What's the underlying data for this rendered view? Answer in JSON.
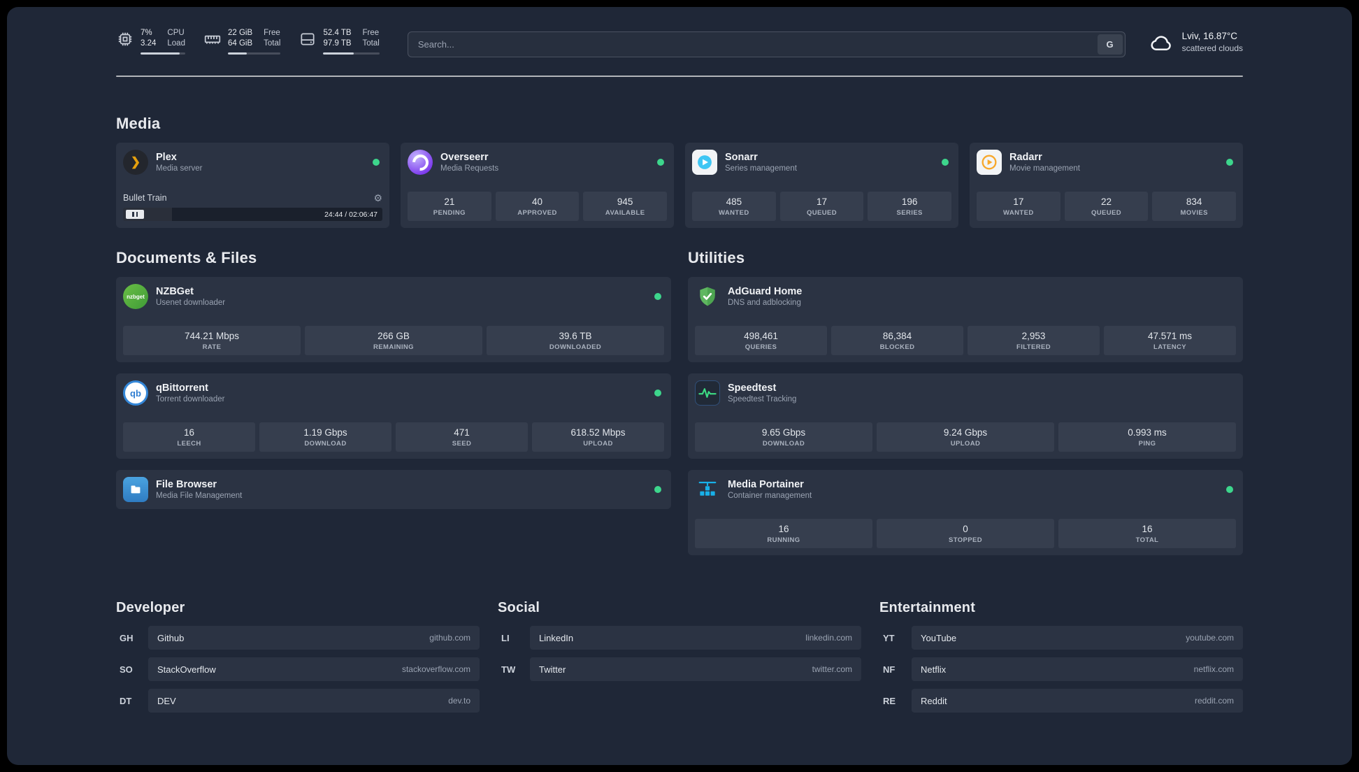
{
  "colors": {
    "status_online": "#3dd68c",
    "accent_plex": "#e5a00d",
    "accent_overseerr": "#7c3aed",
    "accent_sonarr": "#3ec6f4",
    "accent_radarr": "#f7a82c",
    "accent_nzbget": "#54b947",
    "accent_qbittorrent": "#2e7dd1",
    "accent_filebrowser": "#3f9bd8",
    "accent_adguard": "#5fb760",
    "accent_speedtest": "#3ddc84",
    "accent_portainer": "#18b0e8"
  },
  "icons": {
    "gear": "⚙",
    "plex_chevron": "❯"
  },
  "topbar": {
    "cpu": {
      "value_top": "7%",
      "value_bottom": "3.24",
      "label_top": "CPU",
      "label_bottom": "Load"
    },
    "memory": {
      "value_top": "22 GiB",
      "value_bottom": "64 GiB",
      "label_top": "Free",
      "label_bottom": "Total"
    },
    "disk": {
      "value_top": "52.4 TB",
      "value_bottom": "97.9 TB",
      "label_top": "Free",
      "label_bottom": "Total"
    },
    "search": {
      "placeholder": "Search...",
      "provider": "G"
    },
    "weather": {
      "location": "Lviv, 16.87°C",
      "condition": "scattered clouds"
    }
  },
  "media": {
    "title": "Media",
    "plex": {
      "name": "Plex",
      "desc": "Media server",
      "track": "Bullet Train",
      "time": "24:44 / 02:06:47"
    },
    "overseerr": {
      "name": "Overseerr",
      "desc": "Media Requests",
      "stats": [
        {
          "value": "21",
          "label": "PENDING"
        },
        {
          "value": "40",
          "label": "APPROVED"
        },
        {
          "value": "945",
          "label": "AVAILABLE"
        }
      ]
    },
    "sonarr": {
      "name": "Sonarr",
      "desc": "Series management",
      "stats": [
        {
          "value": "485",
          "label": "WANTED"
        },
        {
          "value": "17",
          "label": "QUEUED"
        },
        {
          "value": "196",
          "label": "SERIES"
        }
      ]
    },
    "radarr": {
      "name": "Radarr",
      "desc": "Movie management",
      "stats": [
        {
          "value": "17",
          "label": "WANTED"
        },
        {
          "value": "22",
          "label": "QUEUED"
        },
        {
          "value": "834",
          "label": "MOVIES"
        }
      ]
    }
  },
  "documents": {
    "title": "Documents & Files",
    "nzbget": {
      "name": "NZBGet",
      "desc": "Usenet downloader",
      "icon_text": "nzbget",
      "stats": [
        {
          "value": "744.21 Mbps",
          "label": "RATE"
        },
        {
          "value": "266 GB",
          "label": "REMAINING"
        },
        {
          "value": "39.6 TB",
          "label": "DOWNLOADED"
        }
      ]
    },
    "qbittorrent": {
      "name": "qBittorrent",
      "desc": "Torrent downloader",
      "icon_text": "qb",
      "stats": [
        {
          "value": "16",
          "label": "LEECH"
        },
        {
          "value": "1.19 Gbps",
          "label": "DOWNLOAD"
        },
        {
          "value": "471",
          "label": "SEED"
        },
        {
          "value": "618.52 Mbps",
          "label": "UPLOAD"
        }
      ]
    },
    "filebrowser": {
      "name": "File Browser",
      "desc": "Media File Management"
    }
  },
  "utilities": {
    "title": "Utilities",
    "adguard": {
      "name": "AdGuard Home",
      "desc": "DNS and adblocking",
      "stats": [
        {
          "value": "498,461",
          "label": "QUERIES"
        },
        {
          "value": "86,384",
          "label": "BLOCKED"
        },
        {
          "value": "2,953",
          "label": "FILTERED"
        },
        {
          "value": "47.571 ms",
          "label": "LATENCY"
        }
      ]
    },
    "speedtest": {
      "name": "Speedtest",
      "desc": "Speedtest Tracking",
      "stats": [
        {
          "value": "9.65 Gbps",
          "label": "DOWNLOAD"
        },
        {
          "value": "9.24 Gbps",
          "label": "UPLOAD"
        },
        {
          "value": "0.993 ms",
          "label": "PING"
        }
      ]
    },
    "portainer": {
      "name": "Media Portainer",
      "desc": "Container management",
      "stats": [
        {
          "value": "16",
          "label": "RUNNING"
        },
        {
          "value": "0",
          "label": "STOPPED"
        },
        {
          "value": "16",
          "label": "TOTAL"
        }
      ]
    }
  },
  "bookmarks": {
    "developer": {
      "title": "Developer",
      "items": [
        {
          "abbr": "GH",
          "name": "Github",
          "url": "github.com"
        },
        {
          "abbr": "SO",
          "name": "StackOverflow",
          "url": "stackoverflow.com"
        },
        {
          "abbr": "DT",
          "name": "DEV",
          "url": "dev.to"
        }
      ]
    },
    "social": {
      "title": "Social",
      "items": [
        {
          "abbr": "LI",
          "name": "LinkedIn",
          "url": "linkedin.com"
        },
        {
          "abbr": "TW",
          "name": "Twitter",
          "url": "twitter.com"
        }
      ]
    },
    "entertainment": {
      "title": "Entertainment",
      "items": [
        {
          "abbr": "YT",
          "name": "YouTube",
          "url": "youtube.com"
        },
        {
          "abbr": "NF",
          "name": "Netflix",
          "url": "netflix.com"
        },
        {
          "abbr": "RE",
          "name": "Reddit",
          "url": "reddit.com"
        }
      ]
    }
  }
}
